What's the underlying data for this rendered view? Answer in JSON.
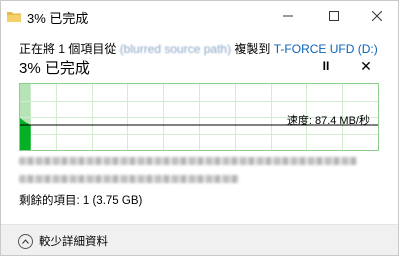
{
  "window": {
    "title": "3% 已完成",
    "icon": "folder-copy-icon",
    "controls": {
      "minimize": "—",
      "maximize": "☐",
      "close": "✕"
    }
  },
  "copy": {
    "prefix": "正在將 1 個項目從 ",
    "source": "(blurred source path)",
    "middle": " 複製到 ",
    "destination": "T-FORCE UFD (D:)"
  },
  "progress": {
    "heading": "3% 已完成",
    "percent": 3,
    "speed": "速度: 87.4 MB/秒",
    "pause_symbol": "II",
    "stop_symbol": "✕",
    "accent_color": "#06b025",
    "fill_color": "#b7e4b7"
  },
  "details": {
    "remaining": "剩餘的項目: 1 (3.75 GB)"
  },
  "footer": {
    "less_details": "較少詳細資料",
    "icon": "chevron-up-icon"
  }
}
